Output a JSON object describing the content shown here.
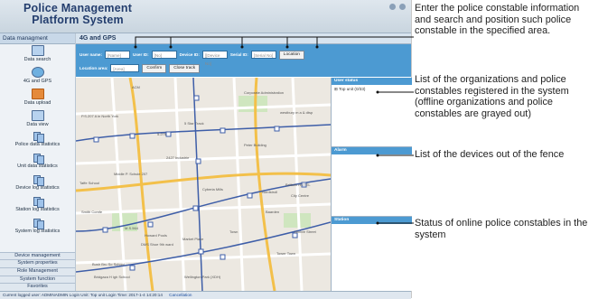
{
  "app": {
    "logo_line1": "Police Management",
    "logo_line2": "Platform System"
  },
  "sidebar": {
    "header": "Data managment",
    "items": [
      {
        "label": "Data search",
        "icon": "data-search-icon"
      },
      {
        "label": "4G and GPS",
        "icon": "globe-icon"
      },
      {
        "label": "Data upload",
        "icon": "upload-icon"
      },
      {
        "label": "Data view",
        "icon": "data-view-icon"
      },
      {
        "label": "Police data statistics",
        "icon": "statistics-icon"
      },
      {
        "label": "Unit data statistics",
        "icon": "statistics-icon"
      },
      {
        "label": "Device log statistics",
        "icon": "statistics-icon"
      },
      {
        "label": "Station log statistics",
        "icon": "statistics-icon"
      },
      {
        "label": "System log statistics",
        "icon": "statistics-icon"
      }
    ],
    "menus": [
      "Device management",
      "System properties",
      "Role Management",
      "System function",
      "Favorites"
    ]
  },
  "main": {
    "title": "4G and GPS",
    "search": {
      "user_name_label": "User name:",
      "user_name_placeholder": "[Name]",
      "user_id_label": "User ID:",
      "user_id_placeholder": "[No]",
      "device_id_label": "Device ID:",
      "device_id_placeholder": "[[Device No]",
      "serial_id_label": "Serial ID:",
      "serial_id_placeholder": "[Serial No]",
      "location_button": "Location",
      "location_area_label": "Location area:",
      "location_area_placeholder": "[Area]",
      "confirm_button": "Confirm",
      "close_track_button": "Close track"
    },
    "map": {
      "labels": [
        "ACM",
        "P.S.207 A in North York",
        "Corporate Administration",
        "westbury m a & dtsp",
        "5 Star Track",
        "5.275",
        "Middle P. Schule 207",
        "2427 Industrie",
        "Peter Building",
        "Taffe School",
        "Cyberia Mills",
        "Nordstroll",
        "Brillium HOTEL",
        "City Centre",
        "Smith Comfe",
        "M.S.564",
        "Howard Pools",
        "DMS Shoe 9th ward",
        "Market Place",
        "Town",
        "Baarden",
        "Tower Town",
        "Umbre Street",
        "Bush Bru So School",
        "Bridgaza H igh School",
        "Wellington Park (XDH)"
      ]
    },
    "panels": {
      "user_status_title": "User status",
      "user_status_item": "Top unit (0/33)",
      "alarm_title": "Alarm",
      "station_title": "Station"
    }
  },
  "status_bar": {
    "text": "Current logged user: ADMINADMIN  Login Unit: Top unit  Login Time: 2017-1-4 14:20:14",
    "cancellation": "Cancellation"
  },
  "callouts": [
    "Enter the police constable information and search and position such police constable in the specified area.",
    "List of the organizations and police constables registered in the system (offline organizations and police constables are grayed out)",
    "List of the devices out of the fence",
    "Status of online police constables in the system"
  ],
  "colors": {
    "search_bar": "#4c9ad2",
    "leader_line": "#111111"
  }
}
